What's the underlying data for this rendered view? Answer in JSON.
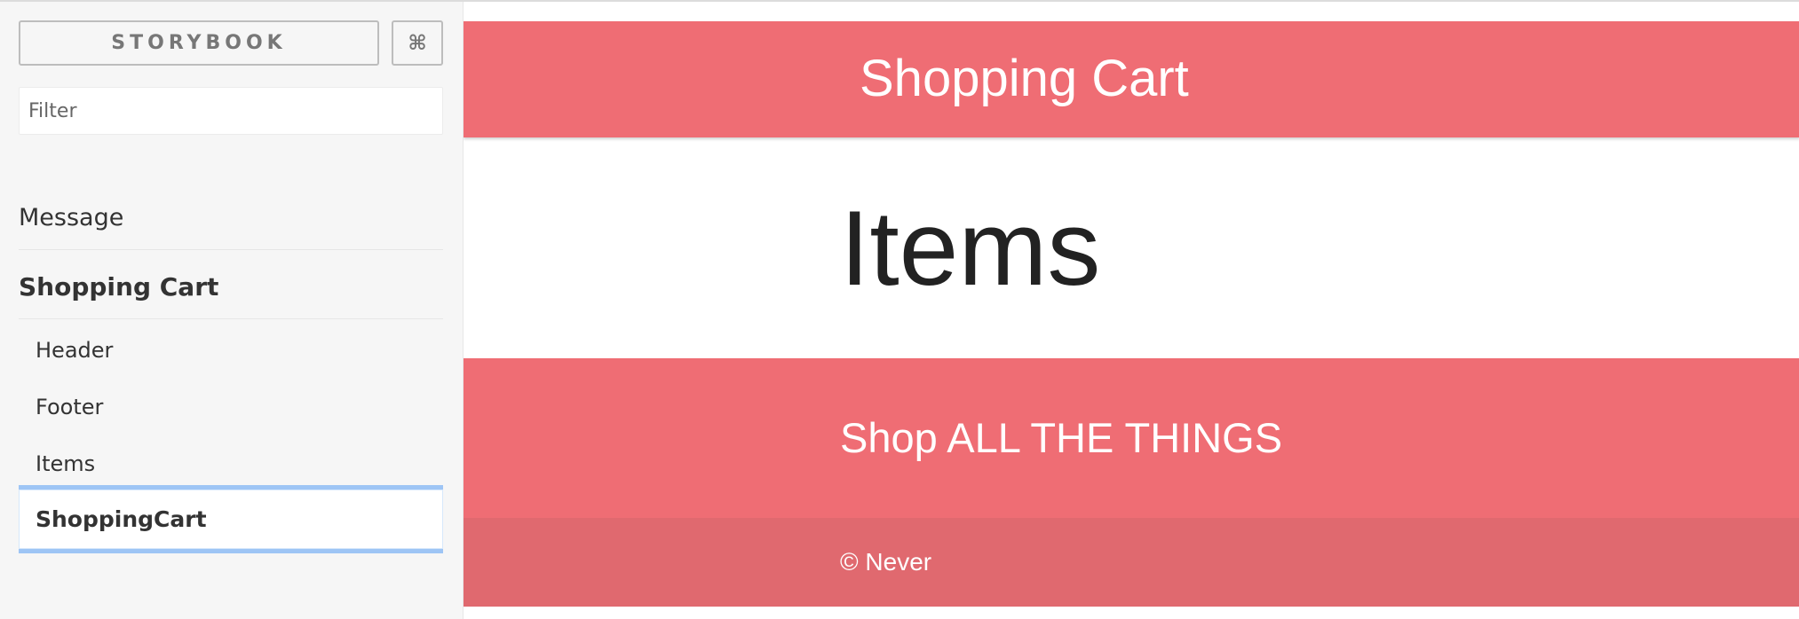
{
  "sidebar": {
    "brand_label": "STORYBOOK",
    "shortcut_label": "⌘",
    "filter": {
      "value": "",
      "placeholder": "Filter"
    },
    "groups": [
      {
        "label": "Message",
        "stories": []
      },
      {
        "label": "Shopping Cart",
        "stories": [
          {
            "label": "Header"
          },
          {
            "label": "Footer"
          },
          {
            "label": "Items"
          },
          {
            "label": "ShoppingCart",
            "selected": true
          }
        ]
      }
    ]
  },
  "preview": {
    "header_title": "Shopping Cart",
    "items_title": "Items",
    "footer_tagline": "Shop ALL THE THINGS",
    "copyright": "© Never"
  },
  "colors": {
    "sidebar_bg": "#f6f6f6",
    "primary": "#ef6d74",
    "footer_dark": "#e0696f",
    "selection": "#9ec5f5",
    "text_dark": "#333333"
  },
  "icons": {
    "shortcut": "command-icon"
  }
}
